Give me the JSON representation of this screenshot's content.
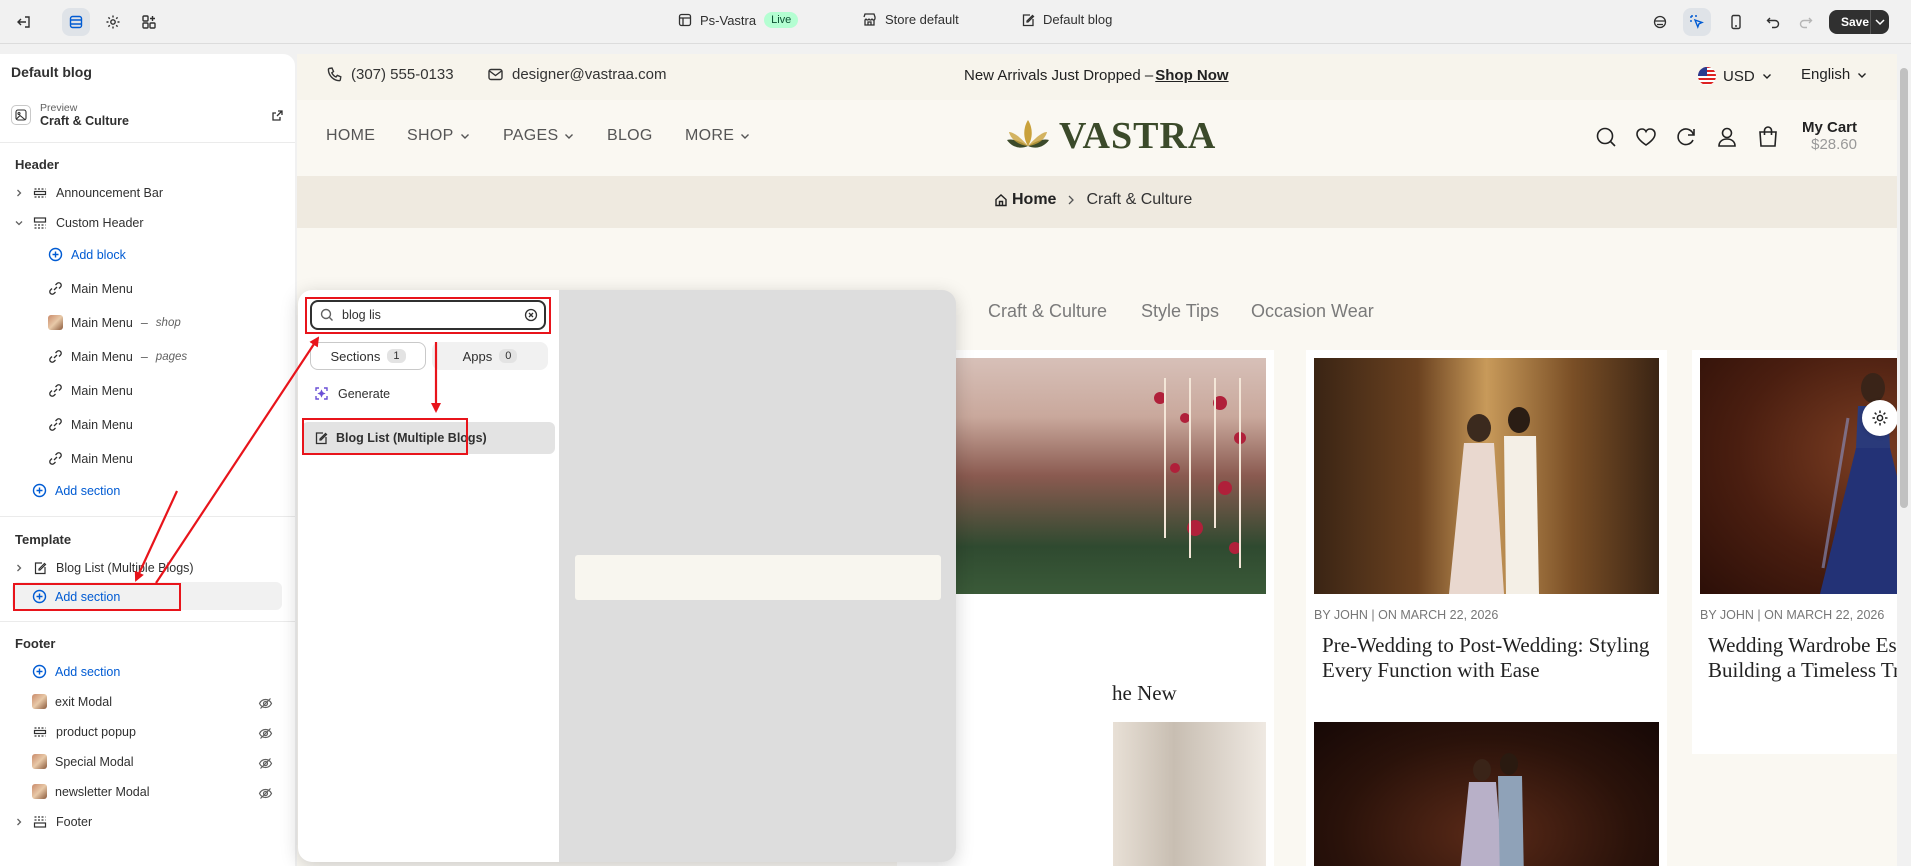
{
  "topbar": {
    "store_name": "Ps-Vastra",
    "live_badge": "Live",
    "store_default": "Store default",
    "template": "Default blog",
    "save_label": "Save"
  },
  "sidebar": {
    "title": "Default blog",
    "preview_label": "Preview",
    "preview_value": "Craft & Culture",
    "header_heading": "Header",
    "announcement_bar": "Announcement Bar",
    "custom_header": "Custom Header",
    "add_block": "Add block",
    "menus": [
      {
        "label": "Main Menu",
        "suffix": ""
      },
      {
        "label": "Main Menu",
        "suffix": "shop"
      },
      {
        "label": "Main Menu",
        "suffix": "pages"
      },
      {
        "label": "Main Menu",
        "suffix": ""
      },
      {
        "label": "Main Menu",
        "suffix": ""
      },
      {
        "label": "Main Menu",
        "suffix": ""
      }
    ],
    "add_section": "Add section",
    "template_heading": "Template",
    "blog_list": "Blog List (Multiple Blogs)",
    "footer_heading": "Footer",
    "footer_items": [
      "exit Modal",
      "product popup",
      "Special Modal",
      "newsletter Modal"
    ],
    "footer": "Footer"
  },
  "picker": {
    "search_value": "blog lis",
    "tabs": [
      {
        "label": "Sections",
        "count": "1"
      },
      {
        "label": "Apps",
        "count": "0"
      }
    ],
    "generate": "Generate",
    "result": "Blog List (Multiple Blogs)"
  },
  "storefront": {
    "phone": "(307) 555-0133",
    "email": "designer@vastraa.com",
    "announcement": "New Arrivals Just Dropped –",
    "shop_now": "Shop Now",
    "currency": "USD",
    "language": "English",
    "nav": [
      "HOME",
      "SHOP",
      "PAGES",
      "BLOG",
      "MORE"
    ],
    "logo": "VASTRA",
    "cart_label": "My Cart",
    "cart_total": "$28.60",
    "breadcrumb_home": "Home",
    "breadcrumb_current": "Craft & Culture",
    "categories": [
      "Craft & Culture",
      "Style Tips",
      "Occasion Wear"
    ],
    "posts": [
      {
        "meta": "",
        "title_line1": "he New",
        "title_line2": ""
      },
      {
        "meta": "BY JOHN | ON MARCH 22, 2026",
        "title_line1": "Pre-Wedding to Post-Wedding: Styling",
        "title_line2": "Every Function with Ease"
      },
      {
        "meta": "BY JOHN | ON MARCH 22, 2026",
        "title_line1": "Wedding Wardrobe Essentials:",
        "title_line2": "Building a Timeless Trousseau"
      }
    ]
  },
  "colors": {
    "accent_blue": "#005bd3",
    "annotation_red": "#e8141b",
    "live_green": "#b4fed2"
  }
}
